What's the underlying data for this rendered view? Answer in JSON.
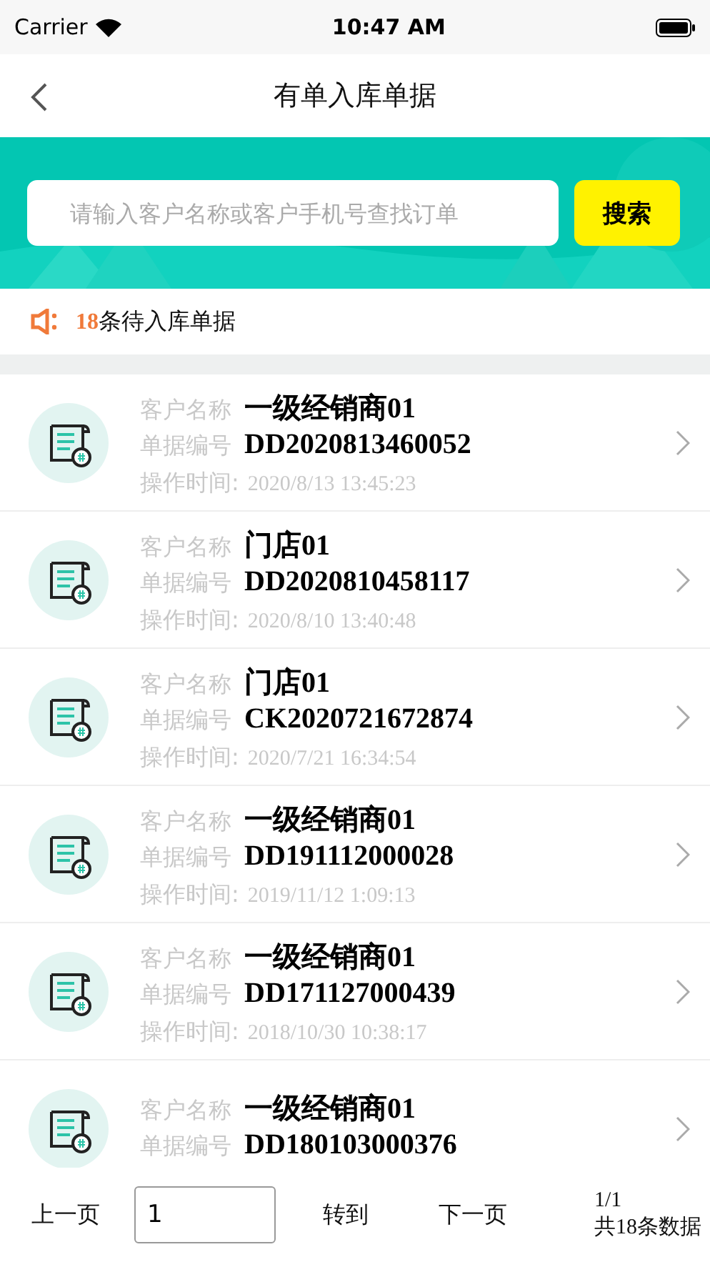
{
  "status_bar": {
    "carrier": "Carrier",
    "time": "10:47 AM"
  },
  "nav": {
    "title": "有单入库单据"
  },
  "search": {
    "placeholder": "请输入客户名称或客户手机号查找订单",
    "button": "搜索"
  },
  "notice": {
    "count": "18",
    "text": "条待入库单据"
  },
  "orders": [
    {
      "customer_label": "客户名称",
      "customer": "一级经销商01",
      "number_label": "单据编号",
      "number": "DD2020813460052",
      "time_label": "操作时间:",
      "time": "2020/8/13 13:45:23"
    },
    {
      "customer_label": "客户名称",
      "customer": "门店01",
      "number_label": "单据编号",
      "number": "DD2020810458117",
      "time_label": "操作时间:",
      "time": "2020/8/10 13:40:48"
    },
    {
      "customer_label": "客户名称",
      "customer": "门店01",
      "number_label": "单据编号",
      "number": "CK2020721672874",
      "time_label": "操作时间:",
      "time": "2020/7/21 16:34:54"
    },
    {
      "customer_label": "客户名称",
      "customer": "一级经销商01",
      "number_label": "单据编号",
      "number": "DD191112000028",
      "time_label": "操作时间:",
      "time": "2019/11/12 1:09:13"
    },
    {
      "customer_label": "客户名称",
      "customer": "一级经销商01",
      "number_label": "单据编号",
      "number": "DD171127000439",
      "time_label": "操作时间:",
      "time": "2018/10/30 10:38:17"
    },
    {
      "customer_label": "客户名称",
      "customer": "一级经销商01",
      "number_label": "单据编号",
      "number": "DD180103000376"
    }
  ],
  "pager": {
    "prev": "上一页",
    "page_value": "1",
    "goto": "转到",
    "next": "下一页",
    "pages": "1/1",
    "total": "共18条数据"
  }
}
